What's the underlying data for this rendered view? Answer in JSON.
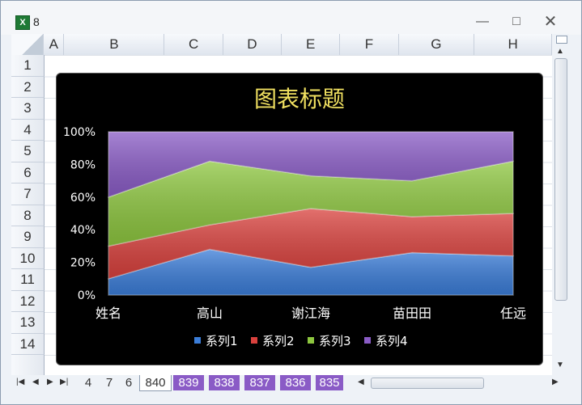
{
  "window": {
    "title": "8",
    "app_icon": "excel-icon"
  },
  "columns": [
    "A",
    "B",
    "C",
    "D",
    "E",
    "F",
    "G",
    "H"
  ],
  "rows": [
    "1",
    "2",
    "3",
    "4",
    "5",
    "6",
    "7",
    "8",
    "9",
    "10",
    "11",
    "12",
    "13",
    "14"
  ],
  "sheet_tabs": [
    {
      "label": "4",
      "style": "normal"
    },
    {
      "label": "7",
      "style": "normal"
    },
    {
      "label": "6",
      "style": "normal"
    },
    {
      "label": "840",
      "style": "active"
    },
    {
      "label": "839",
      "style": "purple"
    },
    {
      "label": "838",
      "style": "purple"
    },
    {
      "label": "837",
      "style": "purple"
    },
    {
      "label": "836",
      "style": "purple"
    },
    {
      "label": "835",
      "style": "purple"
    }
  ],
  "colors": {
    "series1": "#3b7dd8",
    "series2": "#d9413d",
    "series3": "#8dc63f",
    "series4": "#8a5cc6",
    "title": "#f0e060",
    "axis_text": "#ffffff"
  },
  "chart_data": {
    "type": "area",
    "stacked": "100%",
    "title": "图表标题",
    "categories": [
      "姓名",
      "高山",
      "谢江海",
      "苗田田",
      "任远"
    ],
    "series": [
      {
        "name": "系列1",
        "values": [
          10,
          28,
          17,
          26,
          24
        ]
      },
      {
        "name": "系列2",
        "values": [
          20,
          15,
          36,
          22,
          26
        ]
      },
      {
        "name": "系列3",
        "values": [
          30,
          39,
          20,
          22,
          32
        ]
      },
      {
        "name": "系列4",
        "values": [
          40,
          18,
          27,
          30,
          18
        ]
      }
    ],
    "ytick_labels": [
      "0%",
      "20%",
      "40%",
      "60%",
      "80%",
      "100%"
    ],
    "ylim": [
      0,
      100
    ],
    "legend": "bottom"
  }
}
